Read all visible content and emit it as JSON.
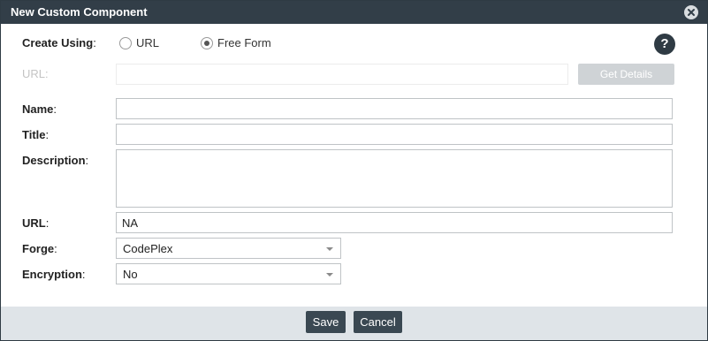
{
  "dialog": {
    "title": "New Custom Component",
    "close_icon": "close-icon"
  },
  "create_using": {
    "label": "Create Using",
    "options": [
      {
        "label": "URL",
        "selected": false
      },
      {
        "label": "Free Form",
        "selected": true
      }
    ],
    "help_icon": "question-mark-icon",
    "help_text": "?"
  },
  "url_lookup": {
    "label": "URL",
    "value": "",
    "button_label": "Get Details",
    "disabled": true
  },
  "form": {
    "name": {
      "label": "Name",
      "value": ""
    },
    "title": {
      "label": "Title",
      "value": ""
    },
    "description": {
      "label": "Description",
      "value": ""
    },
    "url": {
      "label": "URL",
      "value": "NA"
    },
    "forge": {
      "label": "Forge",
      "selected": "CodePlex"
    },
    "encryption": {
      "label": "Encryption",
      "selected": "No"
    }
  },
  "footer": {
    "save_label": "Save",
    "cancel_label": "Cancel"
  },
  "colors": {
    "titlebar": "#323e48",
    "footer": "#dfe4e8",
    "button": "#3a4852",
    "disabled_button": "#cfd3d6"
  }
}
